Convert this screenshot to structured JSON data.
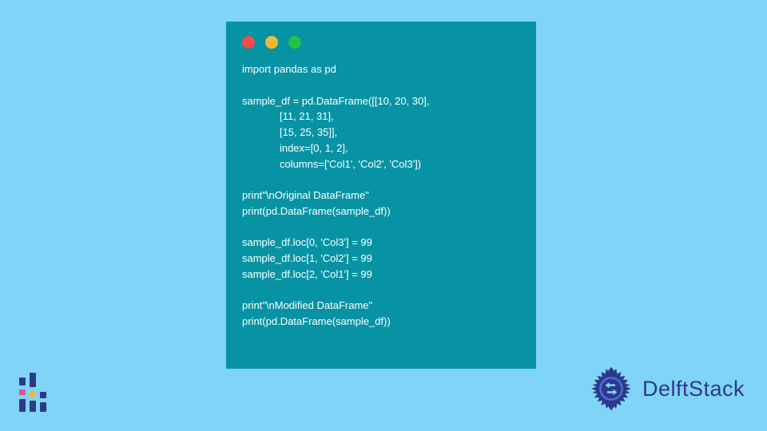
{
  "code": {
    "lines": "import pandas as pd\n\nsample_df = pd.DataFrame([[10, 20, 30],\n             [11, 21, 31],\n             [15, 25, 35]],\n             index=[0, 1, 2],\n             columns=['Col1', 'Col2', 'Col3'])\n\nprint\"\\nOriginal DataFrame\"\nprint(pd.DataFrame(sample_df))\n\nsample_df.loc[0, 'Col3'] = 99\nsample_df.loc[1, 'Col2'] = 99\nsample_df.loc[2, 'Col1'] = 99\n\nprint\"\\nModified DataFrame\"\nprint(pd.DataFrame(sample_df))"
  },
  "window": {
    "lights": [
      "red",
      "yellow",
      "green"
    ]
  },
  "branding": {
    "name": "DelftStack"
  },
  "colors": {
    "page_bg": "#7fd4f7",
    "code_bg": "#0793a4",
    "code_text": "#ffffff",
    "brand_text": "#2c3a8a"
  }
}
